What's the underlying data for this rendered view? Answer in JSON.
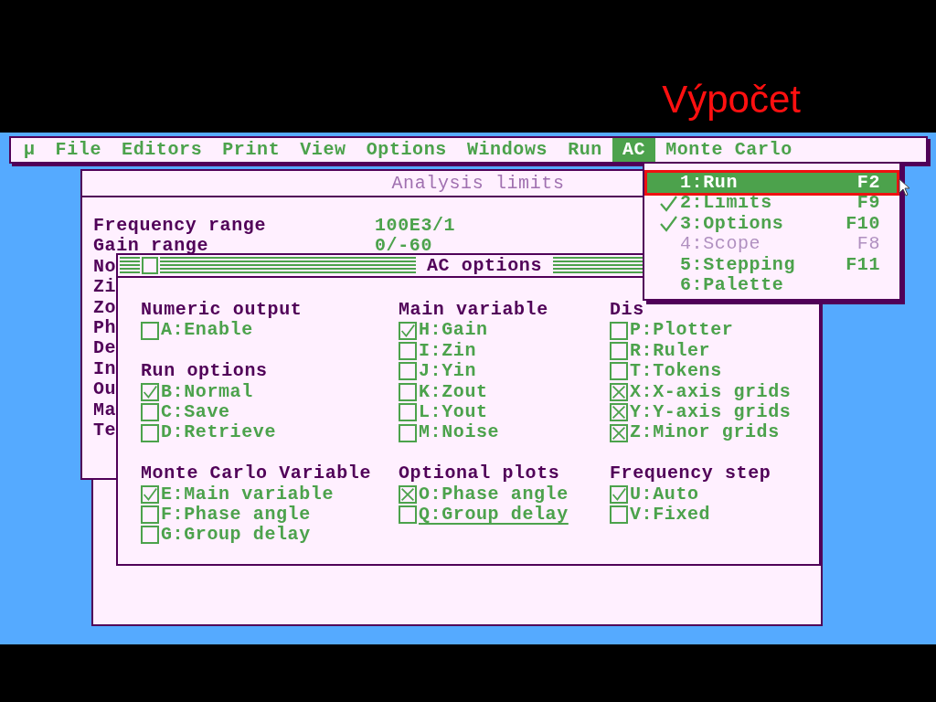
{
  "slide_title": "Výpočet",
  "menu_bar": [
    {
      "label": "µ",
      "selected": false
    },
    {
      "label": "File",
      "selected": false
    },
    {
      "label": "Editors",
      "selected": false
    },
    {
      "label": "Print",
      "selected": false
    },
    {
      "label": "View",
      "selected": false
    },
    {
      "label": "Options",
      "selected": false
    },
    {
      "label": "Windows",
      "selected": false
    },
    {
      "label": "Run",
      "selected": false
    },
    {
      "label": "AC",
      "selected": true
    },
    {
      "label": "Monte Carlo",
      "selected": false
    }
  ],
  "limits_window": {
    "title": "Analysis limits",
    "rows": [
      {
        "label": "Frequency range",
        "value": "100E3/1"
      },
      {
        "label": "Gain range",
        "value": "0/-60"
      },
      {
        "label": "No"
      },
      {
        "label": "Zi"
      },
      {
        "label": "Zo"
      },
      {
        "label": "Ph"
      },
      {
        "label": "De"
      },
      {
        "label": "In"
      },
      {
        "label": "Ou"
      },
      {
        "label": "Ma"
      },
      {
        "label": "Te"
      }
    ]
  },
  "dialog": {
    "title": "AC options",
    "columns": [
      {
        "sections": [
          {
            "heading": "Numeric output",
            "items": [
              {
                "label": "A:Enable",
                "checked": false
              }
            ]
          },
          {
            "heading": "Run options",
            "items": [
              {
                "label": "B:Normal",
                "checked": true,
                "kind": "tick"
              },
              {
                "label": "C:Save",
                "checked": false
              },
              {
                "label": "D:Retrieve",
                "checked": false
              }
            ]
          },
          {
            "heading": "Monte Carlo Variable",
            "items": [
              {
                "label": "E:Main variable",
                "checked": true,
                "kind": "tick"
              },
              {
                "label": "F:Phase angle",
                "checked": false
              },
              {
                "label": "G:Group delay",
                "checked": false
              }
            ]
          }
        ]
      },
      {
        "sections": [
          {
            "heading": "Main variable",
            "items": [
              {
                "label": "H:Gain",
                "checked": true,
                "kind": "tick"
              },
              {
                "label": "I:Zin",
                "checked": false
              },
              {
                "label": "J:Yin",
                "checked": false
              },
              {
                "label": "K:Zout",
                "checked": false
              },
              {
                "label": "L:Yout",
                "checked": false
              },
              {
                "label": "M:Noise",
                "checked": false
              }
            ]
          },
          {
            "heading": "Optional plots",
            "items": [
              {
                "label": "O:Phase angle",
                "checked": true,
                "kind": "cross"
              },
              {
                "label": "Q:Group delay",
                "checked": false,
                "focused": true
              }
            ]
          }
        ]
      },
      {
        "sections": [
          {
            "heading": "Dis",
            "items": [
              {
                "label": "P:Plotter",
                "checked": false
              },
              {
                "label": "R:Ruler",
                "checked": false
              },
              {
                "label": "T:Tokens",
                "checked": false
              },
              {
                "label": "X:X-axis grids",
                "checked": true,
                "kind": "cross"
              },
              {
                "label": "Y:Y-axis grids",
                "checked": true,
                "kind": "cross"
              },
              {
                "label": "Z:Minor grids",
                "checked": true,
                "kind": "cross"
              }
            ]
          },
          {
            "heading": "Frequency step",
            "items": [
              {
                "label": "U:Auto",
                "checked": true,
                "kind": "tick"
              },
              {
                "label": "V:Fixed",
                "checked": false
              }
            ]
          }
        ]
      }
    ]
  },
  "ac_menu": [
    {
      "label": "1:Run",
      "shortcut": "F2",
      "checked": false,
      "disabled": false,
      "selected": true,
      "highlighted": true
    },
    {
      "label": "2:Limits",
      "shortcut": "F9",
      "checked": true,
      "disabled": false,
      "selected": false
    },
    {
      "label": "3:Options",
      "shortcut": "F10",
      "checked": true,
      "disabled": false,
      "selected": false
    },
    {
      "label": "4:Scope",
      "shortcut": "F8",
      "checked": false,
      "disabled": true,
      "selected": false
    },
    {
      "label": "5:Stepping",
      "shortcut": "F11",
      "checked": false,
      "disabled": false,
      "selected": false
    },
    {
      "label": "6:Palette",
      "checked": false,
      "disabled": false,
      "selected": false
    }
  ]
}
